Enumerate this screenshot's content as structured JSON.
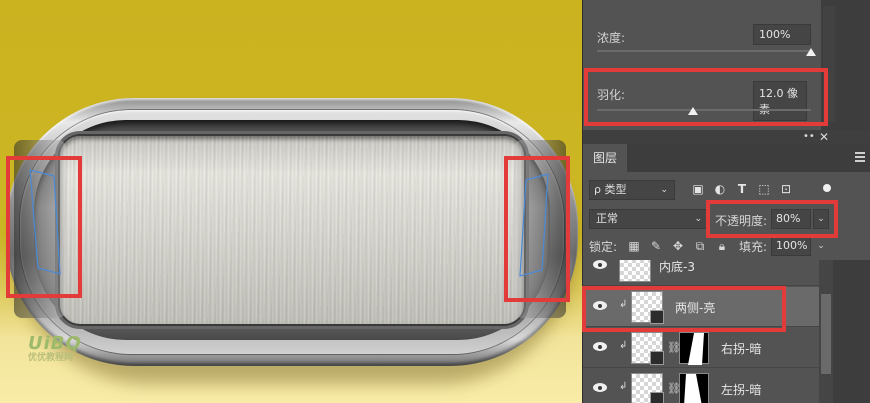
{
  "canvas": {
    "watermark_logo": "UiBQ",
    "watermark_sub": "优优教程网"
  },
  "properties": {
    "density_label": "浓度:",
    "density_value": "100%",
    "density_level": 1.0,
    "feather_label": "羽化:",
    "feather_value": "12.0 像素",
    "feather_level": 0.45
  },
  "panel": {
    "collapse_icon": "double-chevron-icon",
    "close_icon": "close-icon",
    "tab_label": "图层",
    "filter_label": "ρ 类型",
    "filter_icons": [
      "image-filter-icon",
      "adjustment-filter-icon",
      "text-filter-icon",
      "shape-filter-icon",
      "smart-object-filter-icon"
    ],
    "blend_mode": "正常",
    "opacity_label": "不透明度:",
    "opacity_value": "80%",
    "lock_label": "锁定:",
    "lock_icons": [
      "lock-pixels-icon",
      "lock-paint-icon",
      "lock-position-icon",
      "lock-artboard-icon",
      "lock-all-icon"
    ],
    "fill_label": "填充:",
    "fill_value": "100%"
  },
  "layers": [
    {
      "name": "内底-3",
      "selected": false,
      "clipped": false,
      "mask": false
    },
    {
      "name": "两侧-亮",
      "selected": true,
      "clipped": true,
      "mask": false
    },
    {
      "name": "右拐-暗",
      "selected": false,
      "clipped": true,
      "mask": true
    },
    {
      "name": "左拐-暗",
      "selected": false,
      "clipped": true,
      "mask": true
    }
  ],
  "colors": {
    "highlight": "#e33a3a",
    "canvas_yellow": "#cbb21f",
    "path_blue": "#4a8ad8"
  }
}
